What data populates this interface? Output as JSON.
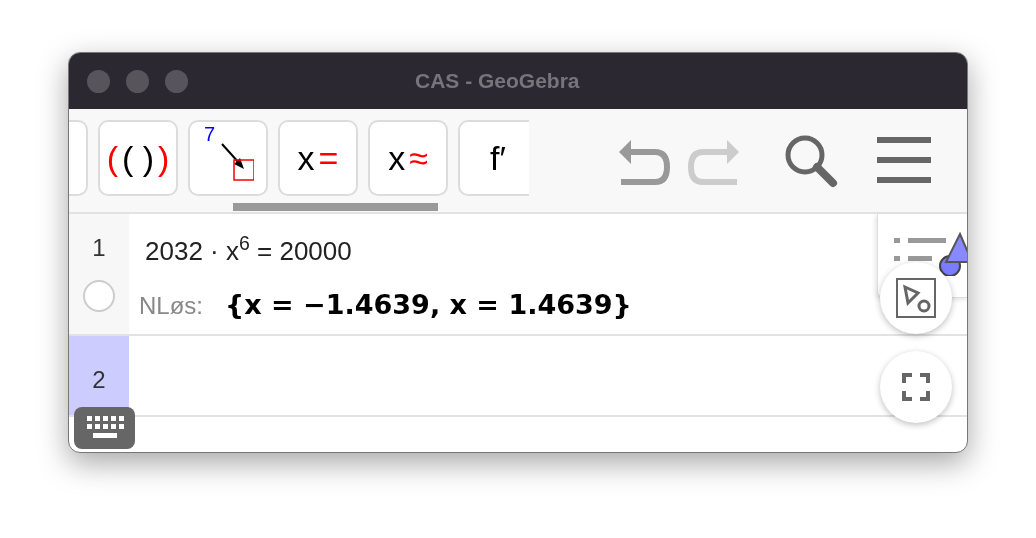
{
  "window": {
    "title": "CAS - GeoGebra"
  },
  "toolbar": {
    "buttons": [
      {
        "kind": "text",
        "segments": [
          {
            "text": "(",
            "color": "#ff0000"
          },
          {
            "text": "( )",
            "color": "#000000"
          },
          {
            "text": ")",
            "color": "#ff0000"
          }
        ]
      },
      {
        "kind": "substitute",
        "segments": [
          {
            "text": "7",
            "color": "#0000ff"
          }
        ]
      },
      {
        "kind": "text",
        "segments": [
          {
            "text": "x",
            "color": "#000000"
          },
          {
            "text": "=",
            "color": "#ff0000"
          }
        ]
      },
      {
        "kind": "text",
        "segments": [
          {
            "text": "x",
            "color": "#000000"
          },
          {
            "text": "≈",
            "color": "#ff0000"
          }
        ]
      },
      {
        "kind": "text",
        "segments": [
          {
            "text": "f′",
            "color": "#000000"
          }
        ]
      }
    ],
    "undo_enabled": true,
    "redo_enabled": false
  },
  "rows": [
    {
      "number": "1",
      "selected": false,
      "shown": false,
      "input": "2032 · x$^{6}$ = 20000",
      "output_label": "NLøs:",
      "output": "{x = −1.4639, x = 1.4639}"
    },
    {
      "number": "2",
      "selected": true
    }
  ]
}
